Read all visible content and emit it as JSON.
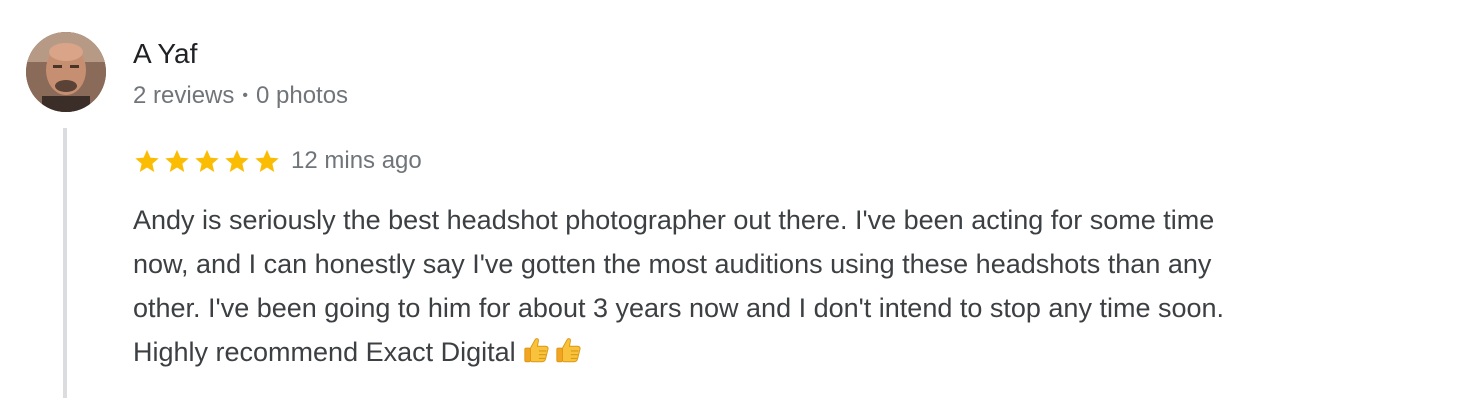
{
  "reviewer": {
    "name": "A Yaf",
    "reviews_count": "2 reviews",
    "separator": "•",
    "photos_count": "0 photos",
    "avatar_icon": "reviewer-avatar-photo"
  },
  "review": {
    "rating": 5,
    "max_rating": 5,
    "star_color": "#fbbc04",
    "time": "12 mins ago",
    "text_line_1": "Andy is seriously the best headshot photographer out there. I've been acting for some time",
    "text_line_2": "now, and I can honestly say I've gotten the most auditions using these headshots than any",
    "text_line_3": "other. I've been going to him for about 3 years now and I don't intend to stop any time soon.",
    "text_line_4": "Highly recommend Exact Digital",
    "emoji": [
      "thumbs-up-icon",
      "thumbs-up-icon"
    ]
  },
  "colors": {
    "name_text": "#202124",
    "meta_text": "#70757a",
    "body_text": "#3c4043",
    "thread_line": "#dadce0"
  }
}
